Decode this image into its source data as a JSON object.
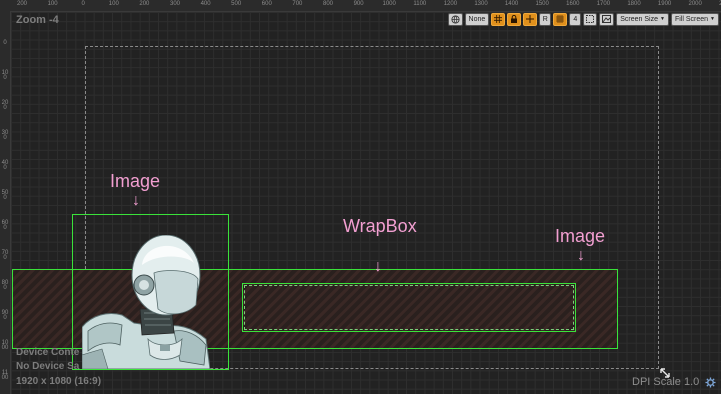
{
  "zoom_label": "Zoom -4",
  "ruler": {
    "top": [
      {
        "label": "200"
      },
      {
        "label": "100"
      },
      {
        "label": "0"
      },
      {
        "label": "100"
      },
      {
        "label": "200"
      },
      {
        "label": "300"
      },
      {
        "label": "400"
      },
      {
        "label": "500"
      },
      {
        "label": "600"
      },
      {
        "label": "700"
      },
      {
        "label": "800"
      },
      {
        "label": "900"
      },
      {
        "label": "1000"
      },
      {
        "label": "1100"
      },
      {
        "label": "1200"
      },
      {
        "label": "1300"
      },
      {
        "label": "1400"
      },
      {
        "label": "1500"
      },
      {
        "label": "1600"
      },
      {
        "label": "1700"
      },
      {
        "label": "1800"
      },
      {
        "label": "1900"
      },
      {
        "label": "2000"
      },
      {
        "label": "2100"
      }
    ],
    "left": [
      {
        "label": "0"
      },
      {
        "label": "100"
      },
      {
        "label": "200"
      },
      {
        "label": "300"
      },
      {
        "label": "400"
      },
      {
        "label": "500"
      },
      {
        "label": "600"
      },
      {
        "label": "700"
      },
      {
        "label": "800"
      },
      {
        "label": "900"
      },
      {
        "label": "1000"
      },
      {
        "label": "1100"
      }
    ]
  },
  "toolbar": {
    "globe_icon": "globe-icon",
    "none_label": "None",
    "r_label": "R",
    "four_label": "4",
    "screen_size_label": "Screen Size",
    "fill_screen_label": "Fill Screen"
  },
  "annotations": {
    "image_left": "Image",
    "wrapbox": "WrapBox",
    "image_right": "Image",
    "arrow": "↓"
  },
  "status": {
    "device_content": "Device Conte",
    "no_device": "No Device Sa",
    "resolution": "1920 x 1080 (16:9)",
    "dpi": "DPI Scale 1.0"
  },
  "colors": {
    "selection_green": "#3ae23a",
    "annotation_pink": "#f29fd1",
    "toolbar_orange": "#e0901c"
  }
}
